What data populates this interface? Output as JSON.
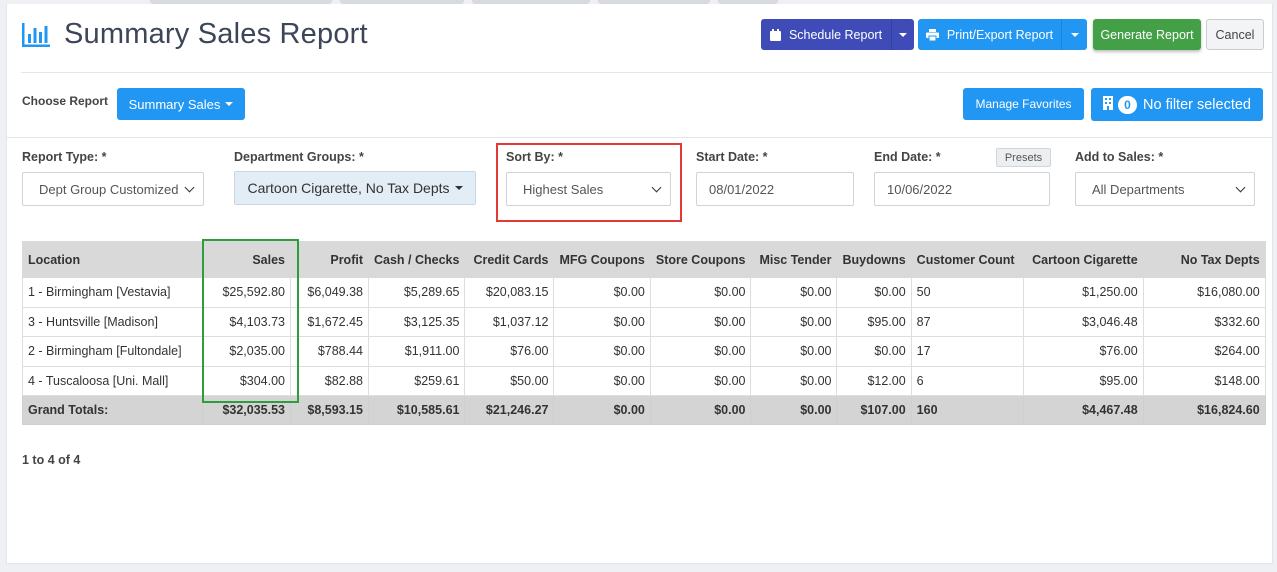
{
  "header": {
    "title": "Summary Sales Report",
    "buttons": {
      "schedule": "Schedule Report",
      "print_export": "Print/Export Report",
      "generate": "Generate Report",
      "cancel": "Cancel"
    }
  },
  "choose_report": {
    "label": "Choose Report",
    "selected": "Summary Sales",
    "manage_favorites": "Manage Favorites",
    "filter_count": "0",
    "filter_text": "No filter selected"
  },
  "filters": {
    "report_type": {
      "label": "Report Type: *",
      "value": "Dept Group Customized"
    },
    "department_groups": {
      "label": "Department Groups: *",
      "value": "Cartoon Cigarette, No Tax Depts"
    },
    "sort_by": {
      "label": "Sort By: *",
      "value": "Highest Sales"
    },
    "start_date": {
      "label": "Start Date: *",
      "value": "08/01/2022"
    },
    "end_date": {
      "label": "End Date: *",
      "value": "10/06/2022",
      "presets": "Presets"
    },
    "add_to_sales": {
      "label": "Add to Sales: *",
      "value": "All Departments"
    }
  },
  "table": {
    "columns": [
      "Location",
      "Sales",
      "Profit",
      "Cash / Checks",
      "Credit Cards",
      "MFG Coupons",
      "Store Coupons",
      "Misc Tender",
      "Buydowns",
      "Customer Count",
      "Cartoon Cigarette",
      "No Tax Depts"
    ],
    "rows": [
      [
        "1 - Birmingham [Vestavia]",
        "$25,592.80",
        "$6,049.38",
        "$5,289.65",
        "$20,083.15",
        "$0.00",
        "$0.00",
        "$0.00",
        "$0.00",
        "50",
        "$1,250.00",
        "$16,080.00"
      ],
      [
        "3 - Huntsville [Madison]",
        "$4,103.73",
        "$1,672.45",
        "$3,125.35",
        "$1,037.12",
        "$0.00",
        "$0.00",
        "$0.00",
        "$95.00",
        "87",
        "$3,046.48",
        "$332.60"
      ],
      [
        "2 - Birmingham [Fultondale]",
        "$2,035.00",
        "$788.44",
        "$1,911.00",
        "$76.00",
        "$0.00",
        "$0.00",
        "$0.00",
        "$0.00",
        "17",
        "$76.00",
        "$264.00"
      ],
      [
        "4 - Tuscaloosa [Uni. Mall]",
        "$304.00",
        "$82.88",
        "$259.61",
        "$50.00",
        "$0.00",
        "$0.00",
        "$0.00",
        "$12.00",
        "6",
        "$95.00",
        "$148.00"
      ]
    ],
    "totals": [
      "Grand Totals:",
      "$32,035.53",
      "$8,593.15",
      "$10,585.61",
      "$21,246.27",
      "$0.00",
      "$0.00",
      "$0.00",
      "$107.00",
      "160",
      "$4,467.48",
      "$16,824.60"
    ]
  },
  "pager": {
    "text": "1 to 4 of 4"
  },
  "colors": {
    "schedule": "#3f4cb8",
    "primary": "#2196f3",
    "generate": "#43a047",
    "highlight_sort": "#e53935",
    "highlight_sales": "#2e9e3a"
  }
}
